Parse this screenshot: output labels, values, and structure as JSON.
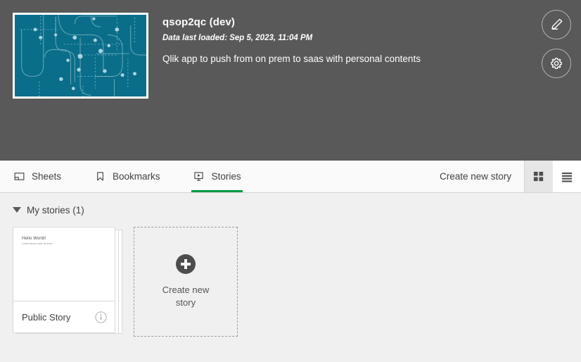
{
  "app": {
    "title": "qsop2qc (dev)",
    "last_loaded": "Data last loaded: Sep 5, 2023, 11:04 PM",
    "description": "Qlik app to push from on prem to saas with personal contents",
    "thumbnail_color": "#0a6e8a",
    "thumbnail_icon": "app-thumbnail-network-pattern"
  },
  "header_actions": {
    "edit": {
      "name": "edit-app-button",
      "icon": "pencil-icon"
    },
    "settings": {
      "name": "app-settings-button",
      "icon": "gear-icon"
    }
  },
  "tabs": [
    {
      "label": "Sheets",
      "icon": "sheet-icon",
      "active": false
    },
    {
      "label": "Bookmarks",
      "icon": "bookmark-icon",
      "active": false
    },
    {
      "label": "Stories",
      "icon": "story-icon",
      "active": true
    }
  ],
  "toolbar": {
    "create_label": "Create new story",
    "grid_view_icon": "grid-view-icon",
    "list_view_icon": "list-view-icon",
    "active_view": "grid"
  },
  "section": {
    "label": "My stories (1)",
    "count": 1,
    "expanded": true,
    "caret_icon": "chevron-down-icon"
  },
  "stories": [
    {
      "name": "Public Story",
      "slide_title": "Hello World!",
      "slide_subtitle": "Lorem ipsum dolor sit amet",
      "info_icon": "info-icon"
    }
  ],
  "create_tile": {
    "label_line1": "Create new",
    "label_line2": "story",
    "plus_icon": "plus-circle-icon"
  },
  "colors": {
    "header_bg": "#595959",
    "accent_green": "#009845",
    "content_bg": "#f0f0f0",
    "tabbar_bg": "#fafafa"
  }
}
